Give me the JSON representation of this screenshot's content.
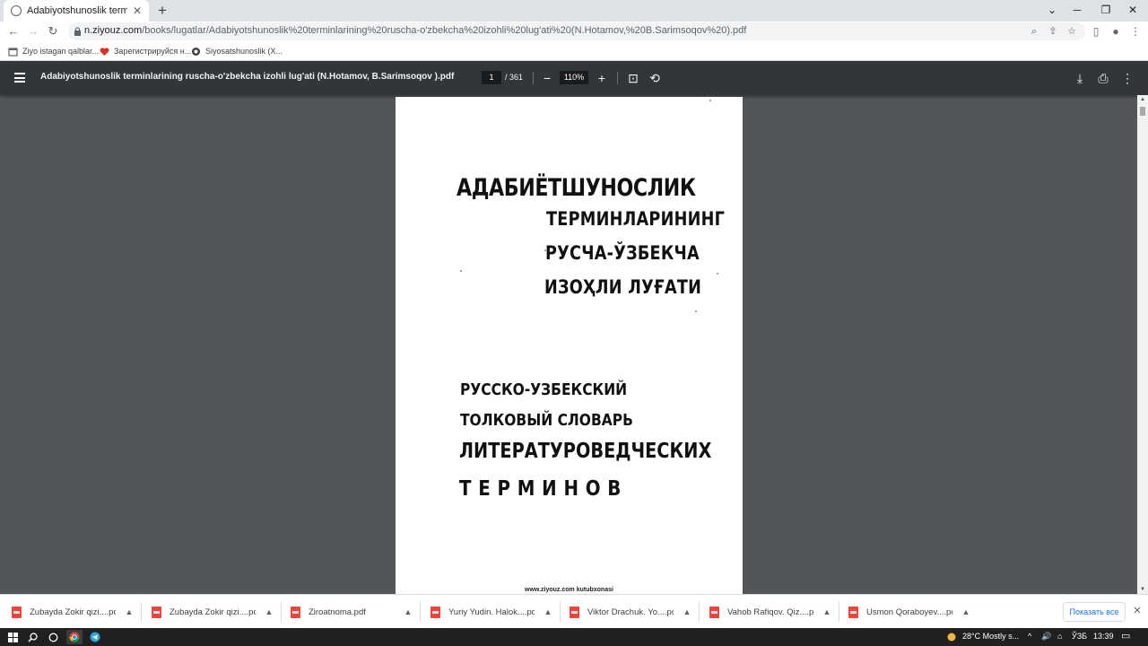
{
  "browser": {
    "tab": {
      "title": "Adabiyotshunoslik terminlarining",
      "close": "✕"
    },
    "new_tab": "+",
    "window_controls": {
      "collapse": "⌄",
      "minimize": "─",
      "restore": "❐",
      "close": "✕"
    },
    "url_host": "n.ziyouz.com",
    "url_path": "/books/lugatlar/Adabiyotshunoslik%20terminlarining%20ruscha-o'zbekcha%20izohli%20lug'ati%20(N.Hotamov,%20B.Sarimsoqov%20).pdf",
    "icons": {
      "zoom": "⌕",
      "share": "⇪",
      "star": "☆",
      "side_panel": "▯",
      "profile": "●",
      "menu": "⋮",
      "back": "←",
      "forward": "→",
      "reload": "↻"
    }
  },
  "bookmarks": [
    {
      "label": "Ziyo istagan qalblar...",
      "icon": "bookmark-page-icon"
    },
    {
      "label": "Зарегистрируйся н...",
      "icon": "red-heart-icon"
    },
    {
      "label": "Siyosatshunoslik (X...",
      "icon": "globe-icon"
    }
  ],
  "pdf_viewer": {
    "title": "Adabiyotshunoslik terminlarining ruscha-o'zbekcha izohli lug'ati (N.Hotamov, B.Sarimsoqov ).pdf",
    "current_page": "1",
    "total_pages": "/ 361",
    "zoom": "110%",
    "zoom_out": "−",
    "zoom_in": "+",
    "fit_icon": "⊡",
    "rotate_icon": "⟲",
    "download_icon": "⤓",
    "print_icon": "⎙",
    "more_icon": "⋮"
  },
  "document_page": {
    "uz_title_line1": "АДАБИЁТШУНОСЛИК",
    "uz_title_line2": "ТЕРМИНЛАРИНИНГ",
    "uz_title_line3": "РУСЧА-ЎЗБЕКЧА",
    "uz_title_line4": "ИЗОҲЛИ ЛУҒАТИ",
    "ru_title_line1": "РУССКО-УЗБЕКСКИЙ",
    "ru_title_line2": "ТОЛКОВЫЙ СЛОВАРЬ",
    "ru_title_line3": "ЛИТЕРАТУРОВЕДЧЕСКИХ",
    "ru_title_line4": "ТЕРМИНОВ",
    "footer": "www.ziyouz.com kutubxonasi"
  },
  "downloads": [
    {
      "name": "Zubayda Zokir qizi....pdf"
    },
    {
      "name": "Zubayda Zokir qizi....pdf"
    },
    {
      "name": "Ziroatnoma.pdf"
    },
    {
      "name": "Yuriy Yudin. Halok....pdf"
    },
    {
      "name": "Viktor Drachuk. Yo....pdf"
    },
    {
      "name": "Vahob Rafiqov. Qiz....pdf"
    },
    {
      "name": "Usmon Qoraboyev....pdf"
    }
  ],
  "downloads_show_all": "Показать все",
  "downloads_close": "✕",
  "taskbar": {
    "weather": "28°C  Mostly s...",
    "language": "ЎЗБ",
    "time": "13:39",
    "tray_chevron": "^",
    "notification_icon": "▭"
  },
  "colors": {
    "pdf_toolbar": "#323639",
    "viewer_bg": "#525659",
    "accent": "#1a73e8",
    "pdf_file_icon": "#e8453c"
  }
}
